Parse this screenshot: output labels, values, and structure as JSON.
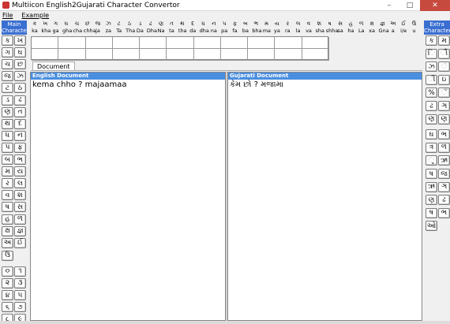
{
  "window": {
    "title": "Multiicon English2Gujarati Character Convertor",
    "controls": [
      "–",
      "□",
      "✕"
    ]
  },
  "menu": [
    "File",
    "Example"
  ],
  "left_panel": {
    "header": "Main Character",
    "buttons": [
      [
        "ક",
        "ખ"
      ],
      [
        "ગ",
        "ઘ"
      ],
      [
        "ચ",
        "છ"
      ],
      [
        "જ",
        "ઝ"
      ],
      [
        "ટ",
        "ઠ"
      ],
      [
        "ડ",
        "ઢ"
      ],
      [
        "ણ",
        "ત"
      ],
      [
        "થ",
        "દ"
      ],
      [
        "ધ",
        "ન"
      ],
      [
        "પ",
        "ફ"
      ],
      [
        "બ",
        "ભ"
      ],
      [
        "મ",
        "ય"
      ],
      [
        "ર",
        "લ"
      ],
      [
        "વ",
        "શ"
      ],
      [
        "ષ",
        "સ"
      ],
      [
        "હ",
        "ળ"
      ],
      [
        "ક્ષ",
        "જ્ઞ"
      ],
      [
        "અ",
        "ઈ"
      ]
    ],
    "single": "ઉ",
    "digits": [
      [
        "૦",
        "૧"
      ],
      [
        "૨",
        "૩"
      ],
      [
        "૪",
        "૫"
      ],
      [
        "૬",
        "૭"
      ],
      [
        "૮",
        "૯"
      ]
    ]
  },
  "right_panel": {
    "header": "Extra Character",
    "buttons": [
      "ક",
      "મ",
      "િ",
      "ૌ",
      "ઝ",
      "ં",
      "ી",
      "ઇ",
      "%",
      "ઁ",
      "ઢ",
      "ઞ",
      "ણ",
      "ણ",
      "ઘ",
      "ભ",
      "ત્ર",
      "ળ",
      "ૃ",
      "ઋ",
      "ષ",
      "જ",
      "ઋ",
      "ઞ",
      "ણ",
      "ઢ",
      "ષ",
      "ભ",
      "ઓ"
    ],
    "extras": [
      "‘",
      "’",
      ":",
      "%",
      "\""
    ]
  },
  "consonants": [
    {
      "g": "ક",
      "e": "ka"
    },
    {
      "g": "ખ",
      "e": "kha"
    },
    {
      "g": "ગ",
      "e": "ga"
    },
    {
      "g": "ઘ",
      "e": "gha"
    },
    {
      "g": "ચ",
      "e": "cha"
    },
    {
      "g": "છ",
      "e": "chha"
    },
    {
      "g": "જ",
      "e": "ja"
    },
    {
      "g": "ઝ",
      "e": "za"
    },
    {
      "g": "ટ",
      "e": "Ta"
    },
    {
      "g": "ઠ",
      "e": "Tha"
    },
    {
      "g": "ડ",
      "e": "Da"
    },
    {
      "g": "ઢ",
      "e": "Dha"
    },
    {
      "g": "ણ",
      "e": "Na"
    },
    {
      "g": "ત",
      "e": "ta"
    },
    {
      "g": "થ",
      "e": "tha"
    },
    {
      "g": "દ",
      "e": "da"
    },
    {
      "g": "ધ",
      "e": "dha"
    },
    {
      "g": "ન",
      "e": "na"
    },
    {
      "g": "પ",
      "e": "pa"
    },
    {
      "g": "ફ",
      "e": "fa"
    },
    {
      "g": "બ",
      "e": "ba"
    },
    {
      "g": "ભ",
      "e": "bha"
    },
    {
      "g": "મ",
      "e": "ma"
    },
    {
      "g": "ય",
      "e": "ya"
    },
    {
      "g": "ર",
      "e": "ra"
    },
    {
      "g": "લ",
      "e": "la"
    },
    {
      "g": "વ",
      "e": "va"
    },
    {
      "g": "શ",
      "e": "sha"
    },
    {
      "g": "ષ",
      "e": "shha"
    },
    {
      "g": "સ",
      "e": "sa"
    },
    {
      "g": "હ",
      "e": "ha"
    },
    {
      "g": "ળ",
      "e": "La"
    },
    {
      "g": "ક્ષ",
      "e": "xa"
    },
    {
      "g": "જ્ઞ",
      "e": "Gna"
    },
    {
      "g": "અ",
      "e": "a"
    },
    {
      "g": "ઈ",
      "e": "i/e"
    },
    {
      "g": "ઉ",
      "e": "u"
    }
  ],
  "tab": {
    "label": "Document"
  },
  "english": {
    "header": "English Document",
    "text": "kema chho ? majaamaa"
  },
  "gujarati": {
    "header": "Gujarati Document",
    "text": "કેમ છો ? મજામા"
  }
}
